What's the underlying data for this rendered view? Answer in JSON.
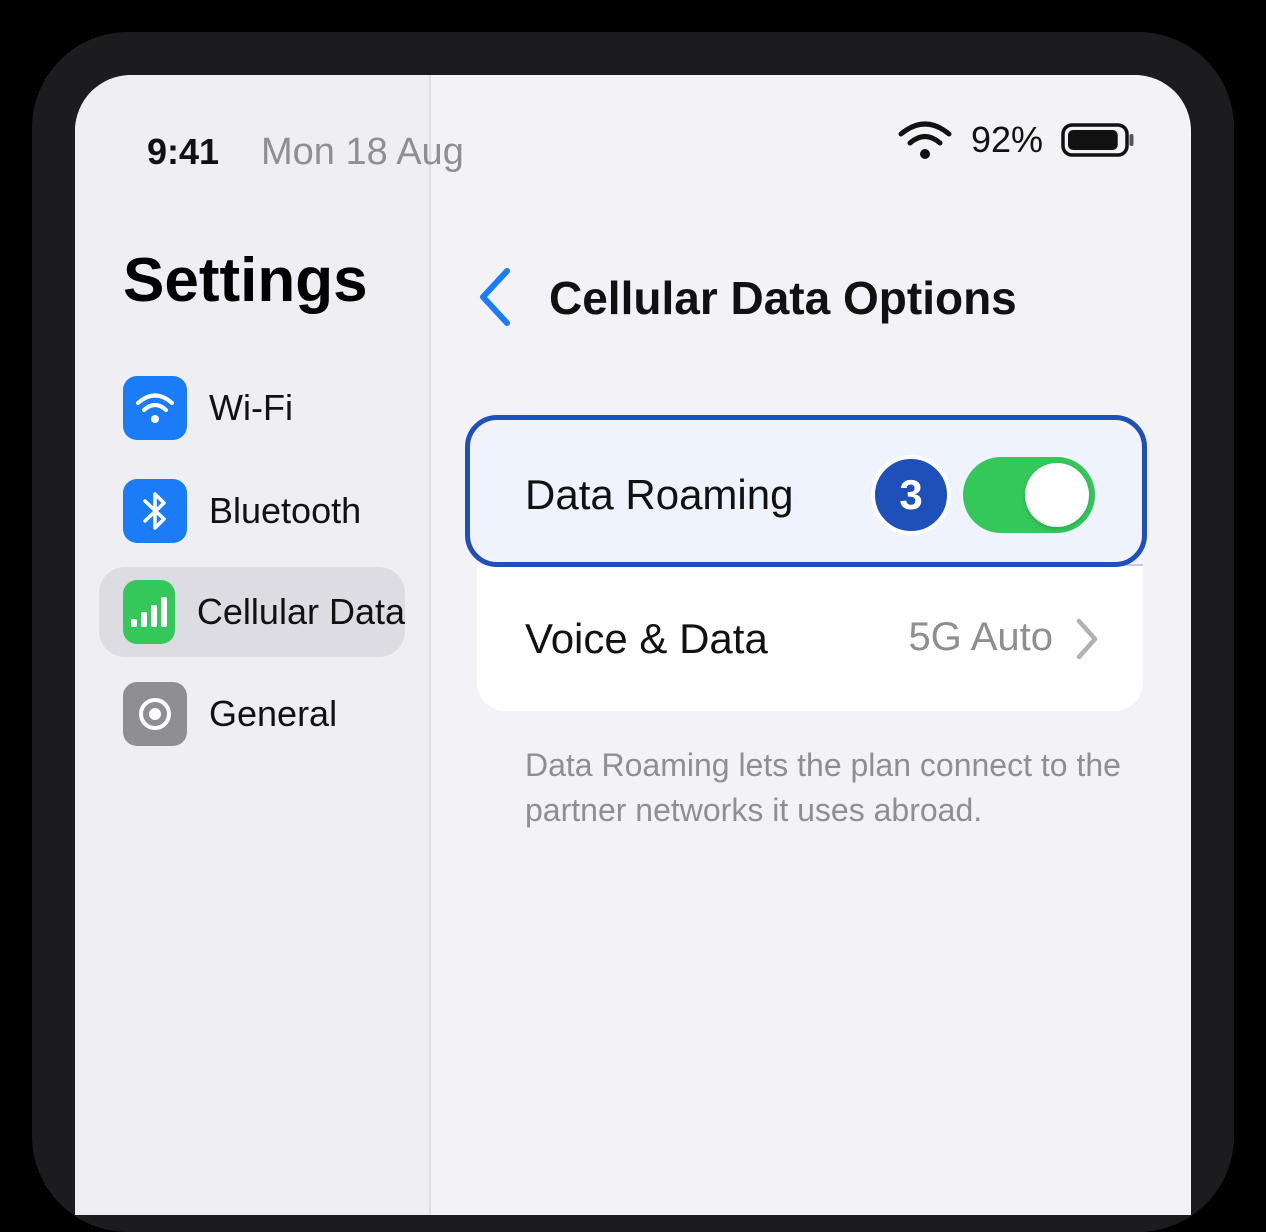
{
  "status_bar": {
    "time": "9:41",
    "date": "Mon 18 Aug",
    "battery_percent": "92%",
    "battery_level": 0.92,
    "icons": [
      "wifi-icon",
      "battery-icon"
    ]
  },
  "sidebar": {
    "title": "Settings",
    "items": [
      {
        "label": "Wi-Fi",
        "icon": "wifi-icon",
        "icon_color": "#1a7cf6",
        "selected": false
      },
      {
        "label": "Bluetooth",
        "icon": "bluetooth-icon",
        "icon_color": "#1a7cf6",
        "selected": false
      },
      {
        "label": "Cellular Data",
        "icon": "cellular-bars-icon",
        "icon_color": "#34c759",
        "selected": true
      },
      {
        "label": "General",
        "icon": "gear-icon",
        "icon_color": "#8e8e93",
        "selected": false
      }
    ]
  },
  "detail": {
    "title": "Cellular Data Options",
    "back_icon": "chevron-left-icon",
    "rows": [
      {
        "label": "Data Roaming",
        "toggle_on": true,
        "badge": "3",
        "highlighted": true
      },
      {
        "label": "Voice & Data",
        "value": "5G Auto",
        "icon": "chevron-right-icon"
      }
    ],
    "footer": "Data Roaming lets the plan connect to the partner networks it uses abroad."
  },
  "colors": {
    "accent": "#1a7cf6",
    "toggle_on": "#34c759",
    "highlight": "#1f4fb8"
  }
}
